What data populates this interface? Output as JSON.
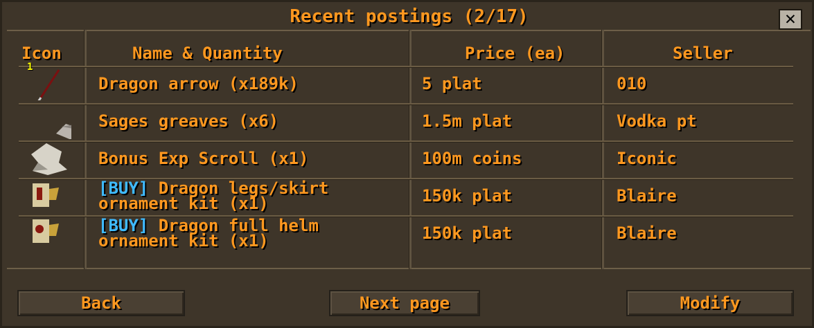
{
  "window": {
    "title": "Recent postings (2/17)",
    "close_label": "✕"
  },
  "columns": {
    "icon": "Icon",
    "name": "Name & Quantity",
    "price": "Price (ea)",
    "seller": "Seller"
  },
  "rows": [
    {
      "icon": "dragon-arrow-icon",
      "qty_overlay": "1",
      "tag": "",
      "name_line1": "Dragon arrow (x189k)",
      "name_line2": "",
      "price": "5 plat",
      "seller": "010"
    },
    {
      "icon": "sages-greaves-icon",
      "tag": "",
      "name_line1": "Sages greaves (x6)",
      "name_line2": "",
      "price": "1.5m plat",
      "seller": "Vodka pt"
    },
    {
      "icon": "scroll-icon",
      "tag": "",
      "name_line1": "Bonus Exp Scroll (x1)",
      "name_line2": "",
      "price": "100m coins",
      "seller": "Iconic"
    },
    {
      "icon": "ornament-kit-icon",
      "tag": "[BUY]",
      "name_line1": " Dragon legs/skirt",
      "name_line2": "ornament kit (x1)",
      "price": "150k plat",
      "seller": "Blaire"
    },
    {
      "icon": "ornament-kit-icon",
      "tag": "[BUY]",
      "name_line1": " Dragon full helm",
      "name_line2": "ornament kit (x1)",
      "price": "150k plat",
      "seller": "Blaire"
    }
  ],
  "buttons": {
    "back": "Back",
    "next": "Next page",
    "modify": "Modify"
  },
  "colors": {
    "text": "#ff981f",
    "buy_tag": "#3fbaff",
    "panel": "#3e3529",
    "qty": "#ffff00"
  }
}
